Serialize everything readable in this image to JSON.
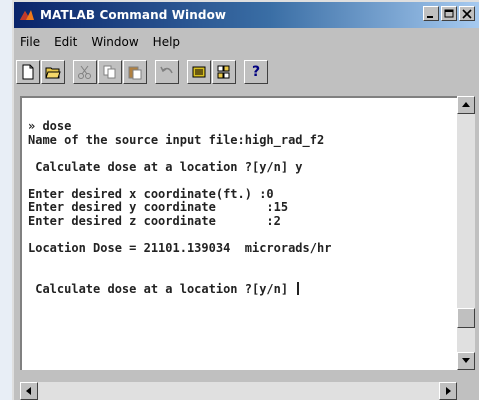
{
  "window": {
    "title": "MATLAB Command Window",
    "titlebar_colors": [
      "#0a246a",
      "#a6caf0"
    ]
  },
  "menu": {
    "items": [
      "File",
      "Edit",
      "Window",
      "Help"
    ]
  },
  "toolbar": {
    "buttons": [
      "new-file",
      "open-folder",
      "cut",
      "copy",
      "paste",
      "undo",
      "workspace-browser",
      "path-browser",
      "help"
    ],
    "help_label": "?"
  },
  "console": {
    "lines": [
      "» dose",
      "Name of the source input file:high_rad_f2",
      "",
      " Calculate dose at a location ?[y/n] y",
      "",
      "Enter desired x coordinate(ft.) :0",
      "Enter desired y coordinate       :15",
      "Enter desired z coordinate       :2",
      "",
      "Location Dose = 21101.139034  microrads/hr",
      "",
      "",
      " Calculate dose at a location ?[y/n] "
    ]
  }
}
